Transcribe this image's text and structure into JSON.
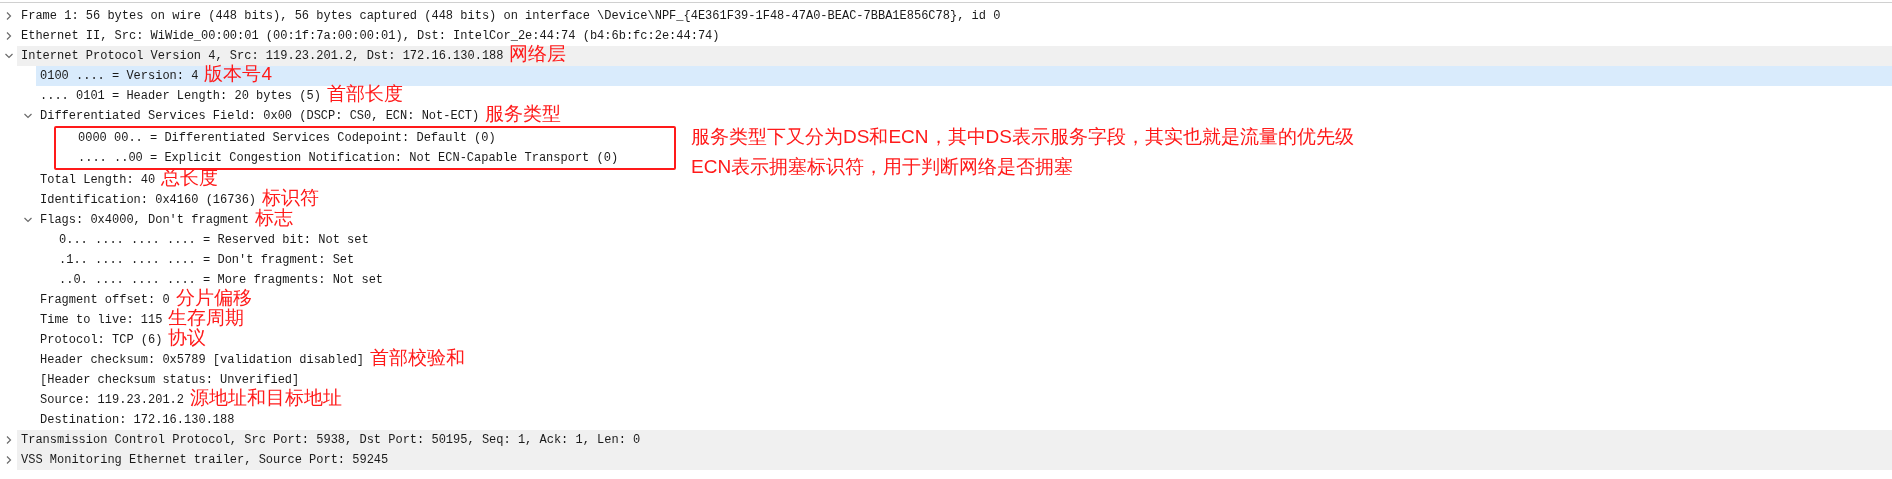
{
  "tree": [
    {
      "label": "Frame 1: 56 bytes on wire (448 bits), 56 bytes captured (448 bits) on interface \\Device\\NPF_{4E361F39-1F48-47A0-BEAC-7BBA1E856C78}, id 0",
      "expanded": false,
      "selected": false,
      "highlighted": false
    },
    {
      "label": "Ethernet II, Src: WiWide_00:00:01 (00:1f:7a:00:00:01), Dst: IntelCor_2e:44:74 (b4:6b:fc:2e:44:74)",
      "expanded": false,
      "selected": false,
      "highlighted": false
    },
    {
      "label": "Internet Protocol Version 4, Src: 119.23.201.2, Dst: 172.16.130.188",
      "expanded": true,
      "selected": false,
      "highlighted": true,
      "annotation": "网络层",
      "children": [
        {
          "label": "0100 .... = Version: 4",
          "selected": true,
          "annotation": "版本号4"
        },
        {
          "label": ".... 0101 = Header Length: 20 bytes (5)",
          "selected": false,
          "highlighted": false,
          "annotation": "首部长度"
        },
        {
          "label": "Differentiated Services Field: 0x00 (DSCP: CS0, ECN: Not-ECT)",
          "expanded": true,
          "selected": false,
          "highlighted": false,
          "annotation": "服务类型",
          "boxed_children": true,
          "note_lines": [
            "服务类型下又分为DS和ECN，其中DS表示服务字段，其实也就是流量的优先级",
            "ECN表示拥塞标识符，用于判断网络是否拥塞"
          ],
          "children": [
            {
              "label": "0000 00.. = Differentiated Services Codepoint: Default (0)",
              "selected": false,
              "highlighted": false
            },
            {
              "label": ".... ..00 = Explicit Congestion Notification: Not ECN-Capable Transport (0)",
              "selected": false,
              "highlighted": false
            }
          ]
        },
        {
          "label": "Total Length: 40",
          "selected": false,
          "highlighted": false,
          "annotation": "总长度"
        },
        {
          "label": "Identification: 0x4160 (16736)",
          "selected": false,
          "highlighted": false,
          "annotation": "标识符"
        },
        {
          "label": "Flags: 0x4000, Don't fragment",
          "expanded": true,
          "selected": false,
          "highlighted": false,
          "annotation": "标志",
          "children": [
            {
              "label": "0... .... .... .... = Reserved bit: Not set",
              "selected": false,
              "highlighted": false
            },
            {
              "label": ".1.. .... .... .... = Don't fragment: Set",
              "selected": false,
              "highlighted": false
            },
            {
              "label": "..0. .... .... .... = More fragments: Not set",
              "selected": false,
              "highlighted": false
            }
          ]
        },
        {
          "label": "Fragment offset: 0",
          "selected": false,
          "highlighted": false,
          "annotation": "分片偏移"
        },
        {
          "label": "Time to live: 115",
          "selected": false,
          "highlighted": false,
          "annotation": "生存周期"
        },
        {
          "label": "Protocol: TCP (6)",
          "selected": false,
          "highlighted": false,
          "annotation": "协议"
        },
        {
          "label": "Header checksum: 0x5789 [validation disabled]",
          "selected": false,
          "highlighted": false,
          "annotation": "首部校验和"
        },
        {
          "label": "[Header checksum status: Unverified]",
          "selected": false,
          "highlighted": false
        },
        {
          "label": "Source: 119.23.201.2",
          "selected": false,
          "highlighted": false,
          "annotation": "源地址和目标地址"
        },
        {
          "label": "Destination: 172.16.130.188",
          "selected": false,
          "highlighted": false
        }
      ]
    },
    {
      "label": "Transmission Control Protocol, Src Port: 5938, Dst Port: 50195, Seq: 1, Ack: 1, Len: 0",
      "expanded": false,
      "selected": false,
      "highlighted": true
    },
    {
      "label": "VSS Monitoring Ethernet trailer, Source Port: 59245",
      "expanded": false,
      "selected": false,
      "highlighted": true
    }
  ]
}
